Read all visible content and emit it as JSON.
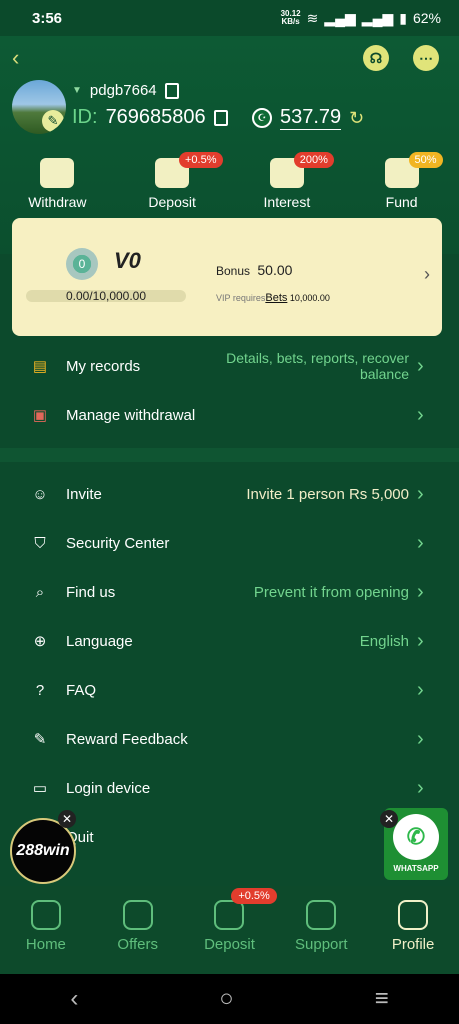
{
  "status_bar": {
    "time": "3:56",
    "speed_value": "30.12",
    "speed_unit": "KB/s",
    "battery": "62%"
  },
  "header": {
    "back_icon": "back-arrow-icon",
    "support_icon": "headset-icon",
    "chat_icon": "chat-icon"
  },
  "profile": {
    "username": "pdgb7664",
    "id_label": "ID:",
    "id_value": "769685806",
    "currency_flag": "pakistan-flag-icon",
    "balance": "537.79"
  },
  "quick_actions": [
    {
      "label": "Withdraw",
      "badge": ""
    },
    {
      "label": "Deposit",
      "badge": "+0.5%"
    },
    {
      "label": "Interest",
      "badge": "200%"
    },
    {
      "label": "Fund",
      "badge": "50%"
    }
  ],
  "vip": {
    "medal_level": "0",
    "level": "V0",
    "progress_text": "0.00/10,000.00",
    "progress": 0.0,
    "bonus_label": "Bonus",
    "bonus_value": "50.00",
    "requires_label": "VIP requires",
    "requires_type": "Bets",
    "requires_value": "10,000.00"
  },
  "menu_top": [
    {
      "label": "My records",
      "value": "Details, bets, reports, recover balance"
    },
    {
      "label": "Manage withdrawal",
      "value": ""
    }
  ],
  "menu": [
    {
      "label": "Invite",
      "value": "Invite 1 person Rs 5,000"
    },
    {
      "label": "Security Center",
      "value": ""
    },
    {
      "label": "Find us",
      "value": "Prevent it from opening"
    },
    {
      "label": "Language",
      "value": "English"
    },
    {
      "label": "FAQ",
      "value": ""
    },
    {
      "label": "Reward Feedback",
      "value": ""
    },
    {
      "label": "Login device",
      "value": ""
    },
    {
      "label": "Quit",
      "value": ""
    }
  ],
  "floating": {
    "logo_text": "288win",
    "whatsapp_label": "WHATSAPP"
  },
  "bottom_nav": [
    {
      "label": "Home",
      "badge": ""
    },
    {
      "label": "Offers",
      "badge": ""
    },
    {
      "label": "Deposit",
      "badge": "+0.5%"
    },
    {
      "label": "Support",
      "badge": ""
    },
    {
      "label": "Profile",
      "badge": ""
    }
  ],
  "colors": {
    "background": "#0c4a2c",
    "accent_green": "#72d48e",
    "card": "#f7f0c2",
    "badge_red": "#e23d2d",
    "badge_gold": "#f1b522"
  }
}
